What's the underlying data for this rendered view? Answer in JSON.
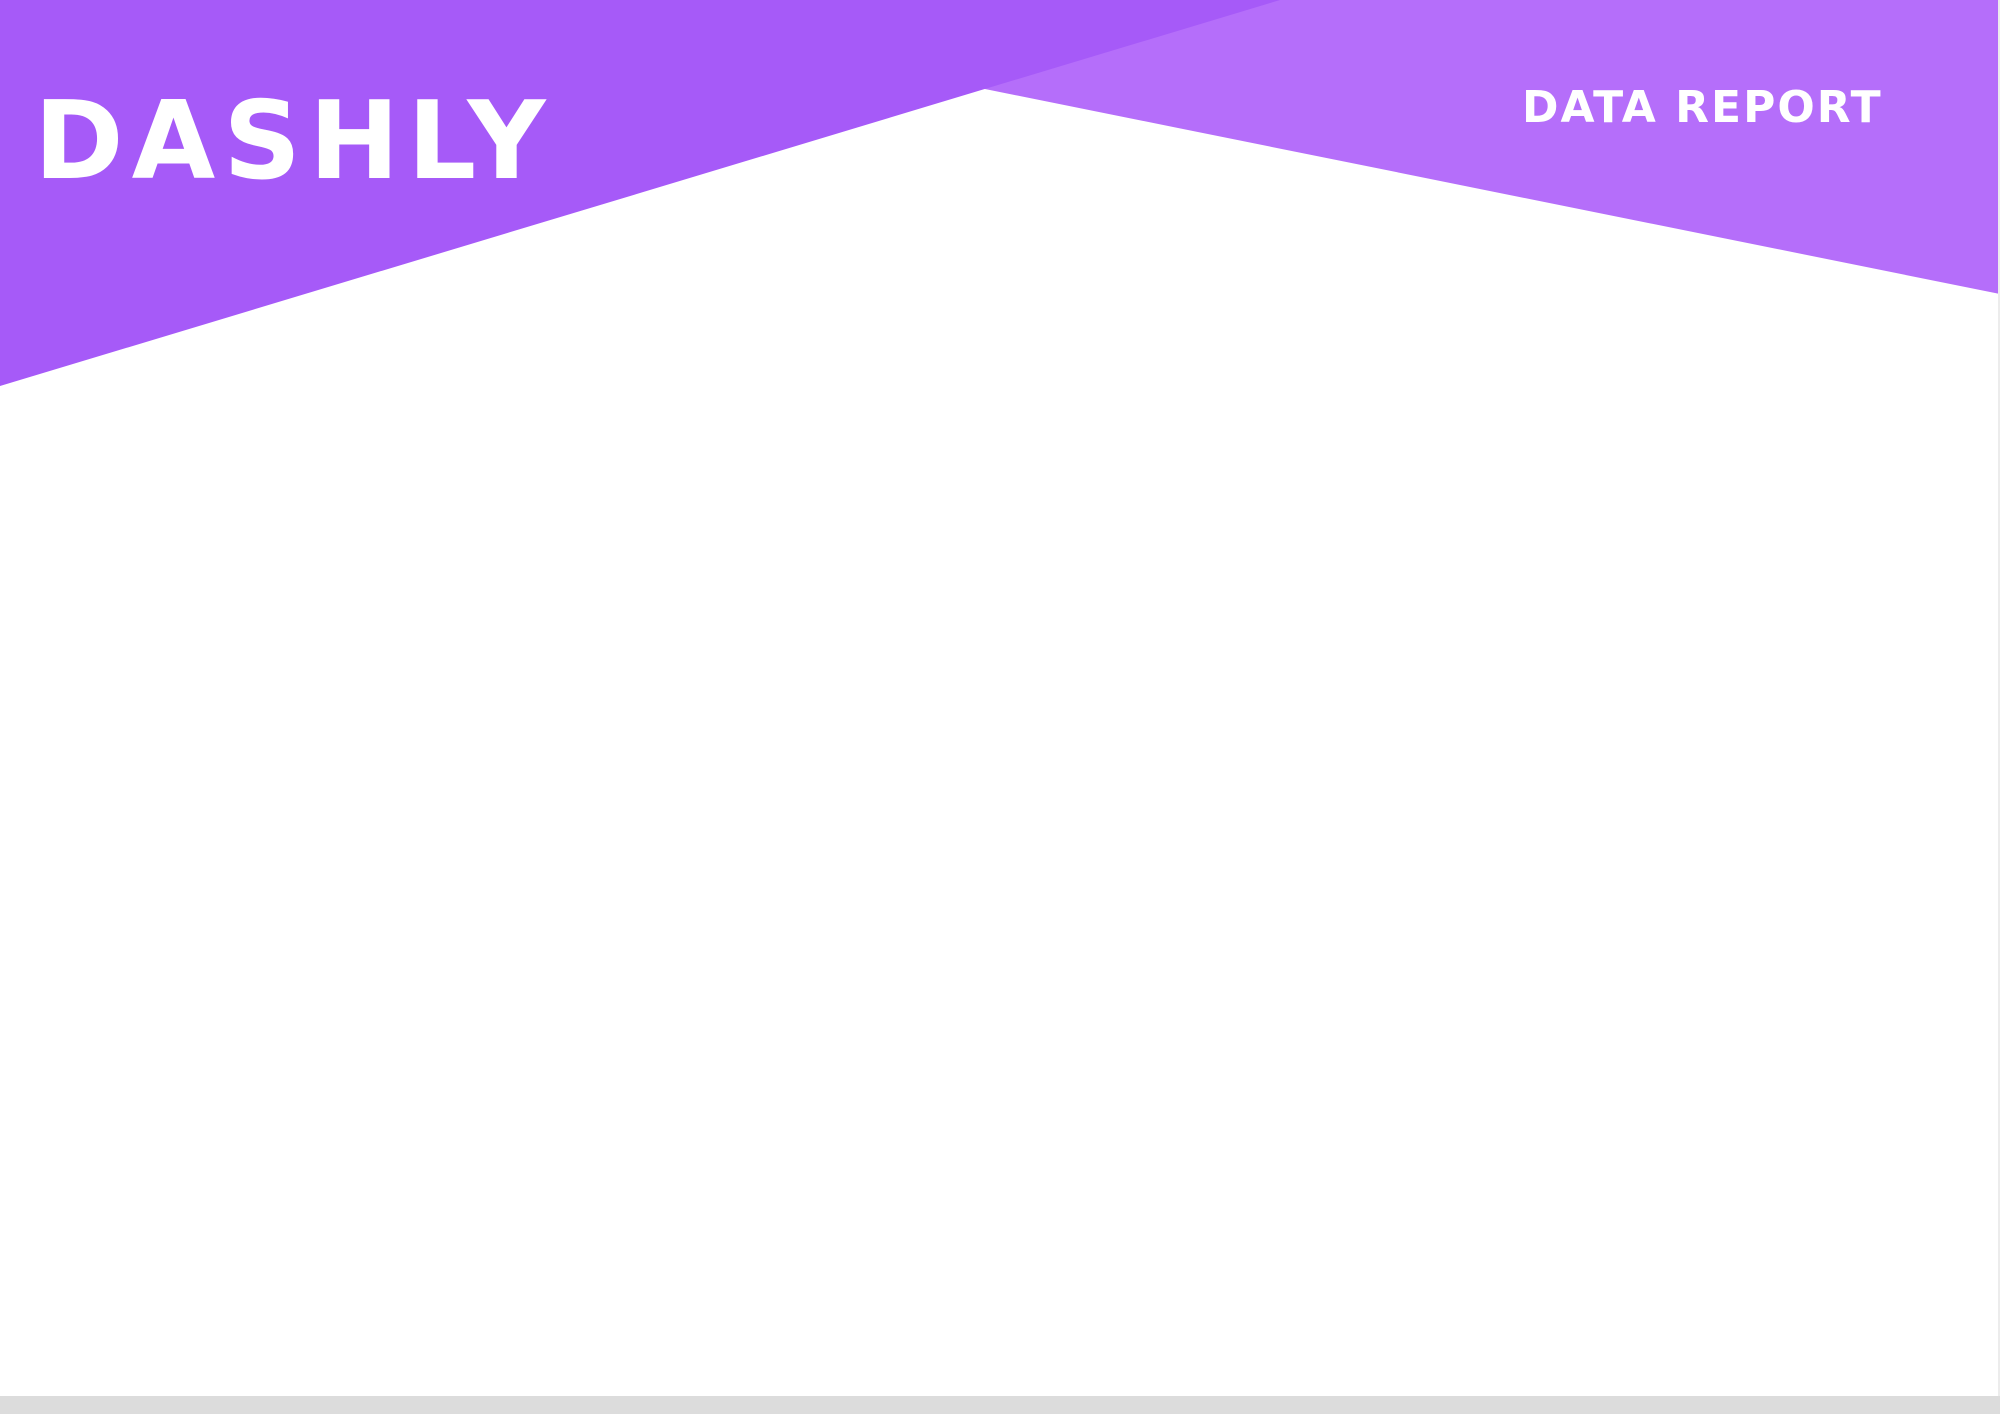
{
  "header": {
    "brand": "DASHLY",
    "report_title": "DATA REPORT"
  },
  "colors": {
    "primary_purple": "#a65af8",
    "light_purple": "#b56efa",
    "page_background": "#ffffff",
    "footer_bar": "#dcdcdc"
  }
}
